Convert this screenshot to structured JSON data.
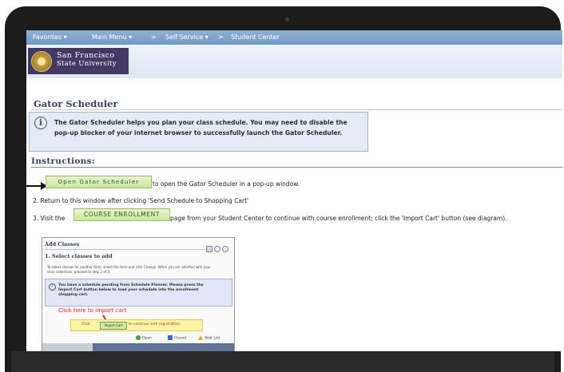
{
  "nav": {
    "favorites": "Favorites ▾",
    "main_menu": "Main Menu ▾",
    "sep1": ">",
    "self_service": "Self Service ▾",
    "sep2": ">",
    "student_center": "Student Center"
  },
  "logo": {
    "line1": "San Francisco",
    "line2": "State University"
  },
  "page": {
    "title": "Gator Scheduler",
    "info": "The Gator Scheduler helps you plan your class schedule.  You may need to disable the pop-up blocker of your internet browser to successfully launch the Gator Scheduler.",
    "instructions_heading": "Instructions:"
  },
  "steps": {
    "open_button": "Open Gator Scheduler",
    "step1_text": "to open the Gator Scheduler in a pop-up window.",
    "step2_text": "2. Return to this window after clicking  'Send Schedule to Shopping Cart'",
    "step3_prefix": "3. Visit the",
    "enroll_button": "COURSE ENROLLMENT",
    "step3_text": "page from your Student Center to continue with course enrollment; click the 'Import Cart' button (see diagram)."
  },
  "diagram": {
    "title": "Add Classes",
    "step": "1. Select classes to add",
    "desc": "To select classes for another term, select the term and click Change.  When you are satisfied with your class selections, proceed to step 2 of 3.",
    "info": "You have a schedule pending from Schedule Planner. Please press the Import Cart button below to load your schedule into the enrollment shopping cart.",
    "red_label": "Click here to import cart",
    "click": "Click",
    "import_btn": "Import Cart",
    "continue": "to continue with registration.",
    "legend_open": "Open",
    "legend_closed": "Closed",
    "legend_wait": "Wait List"
  },
  "colors": {
    "nav": "#7ea3cf",
    "logo_bg": "#453867",
    "button_green": "#d3ecb0",
    "heading": "#33445e"
  }
}
